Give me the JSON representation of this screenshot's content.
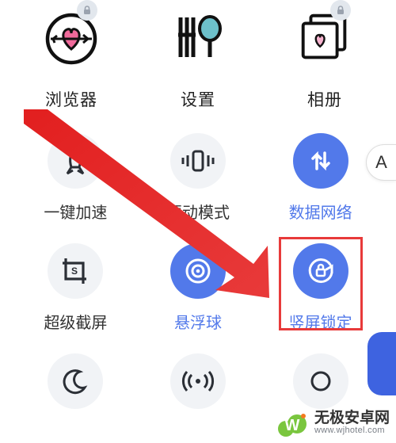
{
  "apps": [
    {
      "id": "browser",
      "label": "浏览器",
      "locked": true
    },
    {
      "id": "settings",
      "label": "设置",
      "locked": false
    },
    {
      "id": "gallery",
      "label": "相册",
      "locked": true
    }
  ],
  "toggles_row1": [
    {
      "id": "speedup",
      "label": "一键加速",
      "on": false
    },
    {
      "id": "vibrate",
      "label": "振动模式",
      "on": false
    },
    {
      "id": "data",
      "label": "数据网络",
      "on": true
    }
  ],
  "toggles_row2": [
    {
      "id": "screenshot",
      "label": "超级截屏",
      "on": false
    },
    {
      "id": "hover",
      "label": "悬浮球",
      "on": true
    },
    {
      "id": "rotlock",
      "label": "竖屏锁定",
      "on": true,
      "highlighted": true
    }
  ],
  "side_button": {
    "label": "A"
  },
  "watermark": {
    "brand": "无极安卓网",
    "url": "www.wjhotel.com"
  },
  "colors": {
    "accent": "#5279ea",
    "highlight": "#e83a3a"
  }
}
